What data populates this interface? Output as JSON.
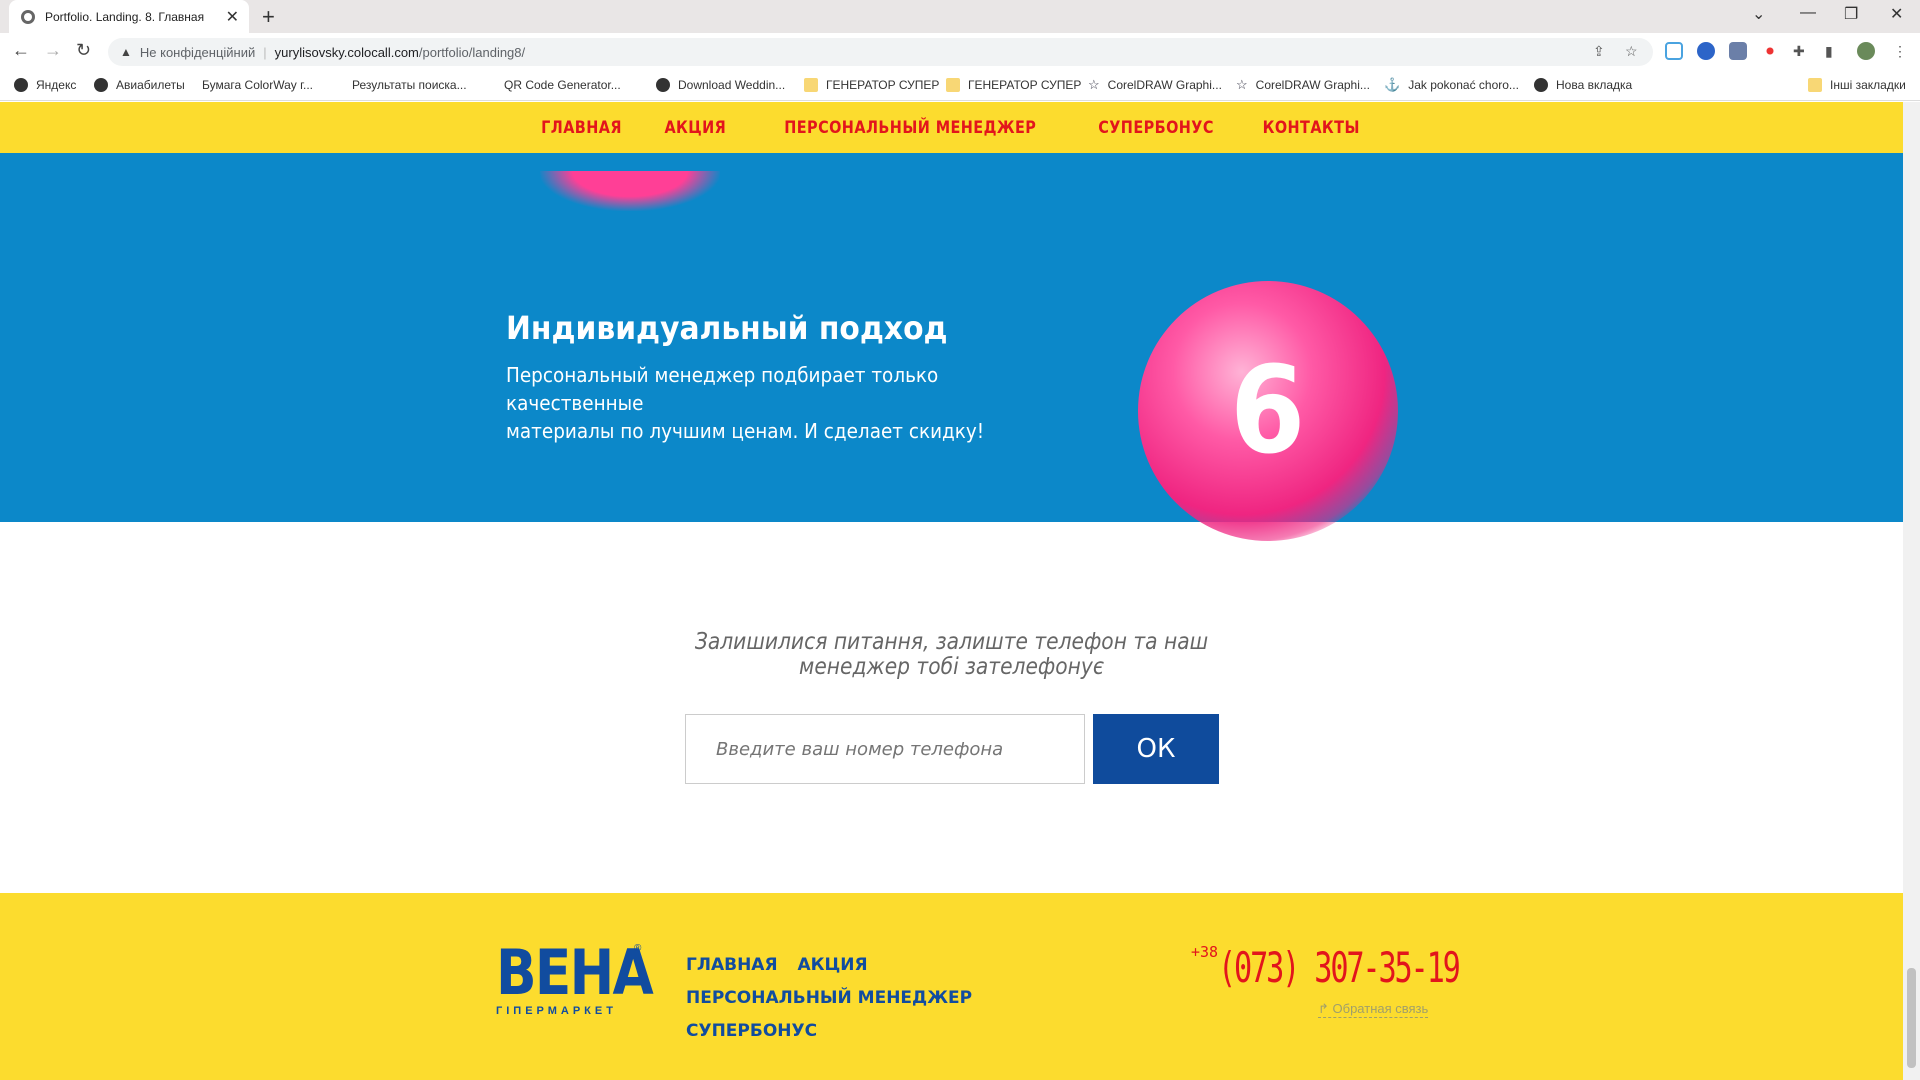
{
  "browser": {
    "tab_title": "Portfolio. Landing. 8. Главная",
    "insecure_label": "Не конфіденційний",
    "url_host": "yurylisovsky.colocall.com",
    "url_path": "/portfolio/landing8/",
    "bookmarks": [
      "Яндекс",
      "Авиабилеты",
      "Бумага ColorWay г...",
      "Результаты поиска...",
      "QR Code Generator...",
      "Download Weddin...",
      "ГЕНЕРАТОР СУПЕР",
      "ГЕНЕРАТОР СУПЕР",
      "CorelDRAW Graphi...",
      "CorelDRAW Graphi...",
      "Jak pokonać choro...",
      "Нова вкладка",
      "Інші закладки"
    ]
  },
  "nav": {
    "items": [
      "ГЛАВНАЯ",
      "АКЦИЯ",
      "ПЕРСОНАЛЬНЫЙ МЕНЕДЖЕР",
      "СУПЕРБОНУС",
      "КОНТАКТЫ"
    ]
  },
  "feature": {
    "title": "Индивидуальный подход",
    "desc_line1": "Персональный менеджер подбирает только качественные",
    "desc_line2": "материалы по лучшим ценам. И сделает скидку!",
    "number": "6"
  },
  "callback": {
    "line1": "Залишилися питання, залиште телефон та наш",
    "line2": "менеджер тобі зателефонує",
    "placeholder": "Введите ваш номер телефона",
    "button": "ОК"
  },
  "footer": {
    "logo_main": "ВЕНА",
    "logo_reg": "®",
    "logo_sub": "ГІПЕРМАРКЕТ",
    "nav": [
      "ГЛАВНАЯ",
      "АКЦИЯ",
      "ПЕРСОНАЛЬНЫЙ МЕНЕДЖЕР",
      "СУПЕРБОНУС"
    ],
    "phone_cc": "+38",
    "phone_num": "(073) 307-35-19",
    "feedback": "Обратная связь"
  }
}
